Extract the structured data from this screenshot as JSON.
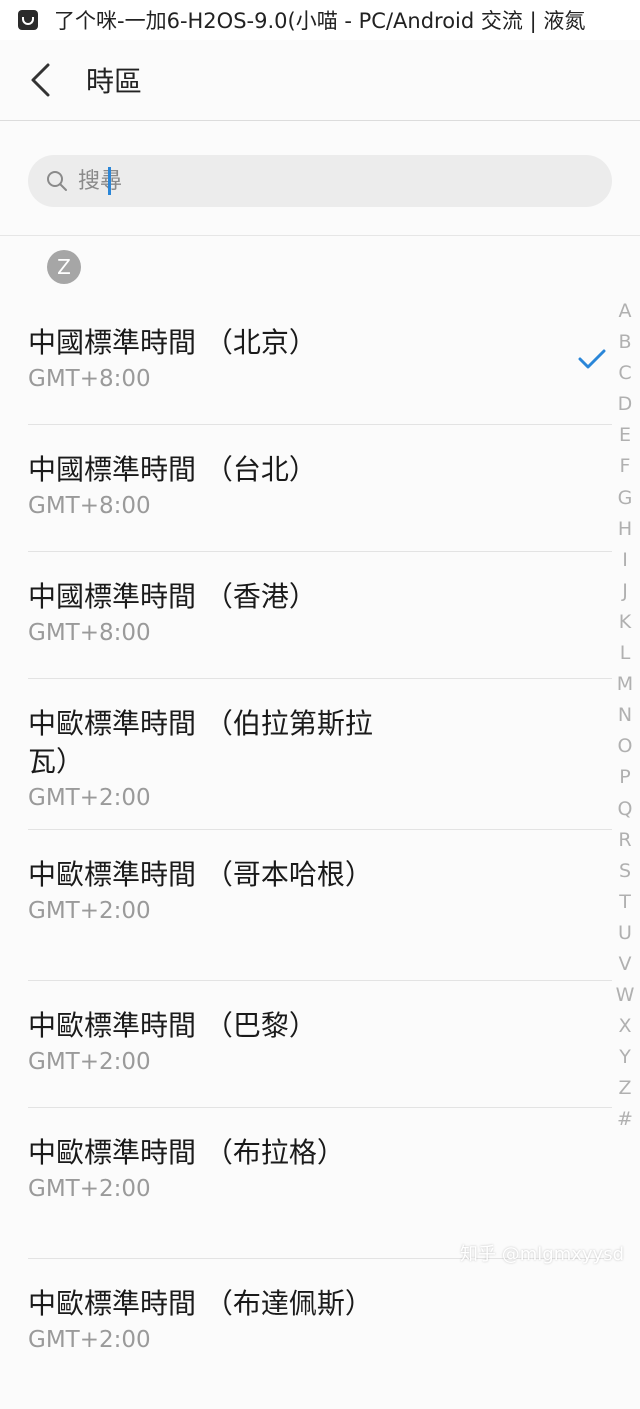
{
  "notification": {
    "icon": "app-notification-icon",
    "text": "了个咪-一加6-H2OS-9.0(小喵 - PC/Android 交流 | 液氮"
  },
  "header": {
    "back_icon": "chevron-left-icon",
    "title": "時區"
  },
  "search": {
    "icon": "search-icon",
    "placeholder": "搜尋",
    "value": ""
  },
  "section": {
    "letter": "Z"
  },
  "timezones": [
    {
      "name": "中國標準時間 （北京）",
      "offset": "GMT+8:00",
      "selected": true
    },
    {
      "name": "中國標準時間 （台北）",
      "offset": "GMT+8:00",
      "selected": false
    },
    {
      "name": "中國標準時間 （香港）",
      "offset": "GMT+8:00",
      "selected": false
    },
    {
      "name": "中歐標準時間 （伯拉第斯拉瓦）",
      "offset": "GMT+2:00",
      "selected": false
    },
    {
      "name": "中歐標準時間 （哥本哈根）",
      "offset": "GMT+2:00",
      "selected": false
    },
    {
      "name": "中歐標準時間 （巴黎）",
      "offset": "GMT+2:00",
      "selected": false
    },
    {
      "name": "中歐標準時間 （布拉格）",
      "offset": "GMT+2:00",
      "selected": false
    },
    {
      "name": "中歐標準時間 （布達佩斯）",
      "offset": "GMT+2:00",
      "selected": false
    }
  ],
  "index_letters": [
    "A",
    "B",
    "C",
    "D",
    "E",
    "F",
    "G",
    "H",
    "I",
    "J",
    "K",
    "L",
    "M",
    "N",
    "O",
    "P",
    "Q",
    "R",
    "S",
    "T",
    "U",
    "V",
    "W",
    "X",
    "Y",
    "Z",
    "#"
  ],
  "watermark": "知乎 @mlgmxyysd",
  "colors": {
    "accent": "#2a86d8",
    "secondary_text": "#9a9a9a",
    "index_text": "#b0b0b0",
    "badge_bg": "#a6a6a6"
  }
}
